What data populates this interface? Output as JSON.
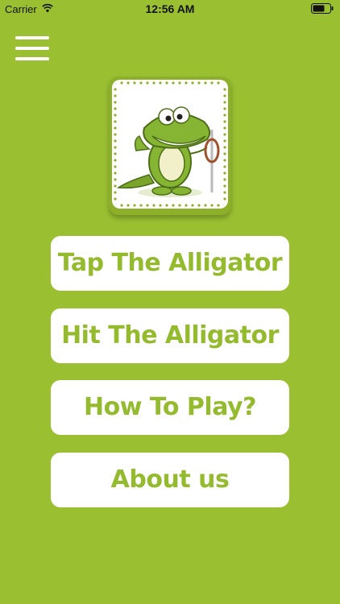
{
  "status_bar": {
    "carrier": "Carrier",
    "time": "12:56 AM",
    "wifi_icon": "wifi-icon",
    "battery_icon": "battery-icon"
  },
  "menu": {
    "icon": "hamburger-menu-icon"
  },
  "logo": {
    "icon": "alligator-logo-image"
  },
  "buttons": {
    "tap": "Tap The Alligator",
    "hit": "Hit The Alligator",
    "how_to_play": "How To Play?",
    "about": "About us"
  },
  "colors": {
    "background": "#9abf31",
    "button_background": "#ffffff",
    "button_text": "#94bb2e"
  }
}
